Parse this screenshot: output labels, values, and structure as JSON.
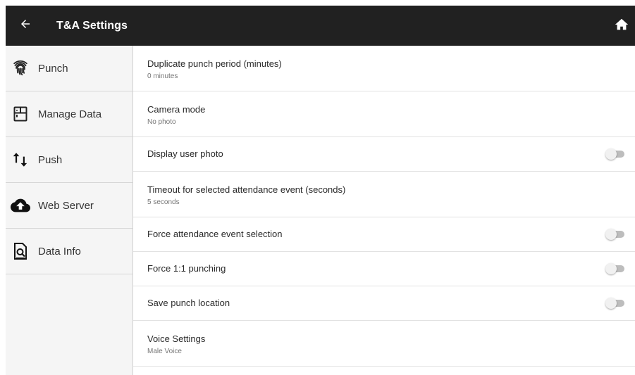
{
  "appbar": {
    "title": "T&A Settings",
    "back_icon": "arrow-left-icon",
    "home_icon": "home-icon",
    "background": "#212121"
  },
  "sidebar": {
    "items": [
      {
        "label": "Punch",
        "icon": "fingerprint-icon"
      },
      {
        "label": "Manage Data",
        "icon": "database-icon"
      },
      {
        "label": "Push",
        "icon": "swap-vertical-icon"
      },
      {
        "label": "Web Server",
        "icon": "cloud-upload-icon"
      },
      {
        "label": "Data Info",
        "icon": "document-search-icon"
      }
    ]
  },
  "settings": {
    "items": [
      {
        "title": "Duplicate punch period (minutes)",
        "value": "0 minutes"
      },
      {
        "title": "Camera mode",
        "value": "No photo"
      },
      {
        "title": "Display user photo",
        "toggle": "off"
      },
      {
        "title": "Timeout for selected attendance event (seconds)",
        "value": "5 seconds"
      },
      {
        "title": "Force attendance event selection",
        "toggle": "off"
      },
      {
        "title": "Force 1:1 punching",
        "toggle": "off"
      },
      {
        "title": "Save punch location",
        "toggle": "off"
      },
      {
        "title": "Voice Settings",
        "value": "Male Voice"
      }
    ]
  }
}
